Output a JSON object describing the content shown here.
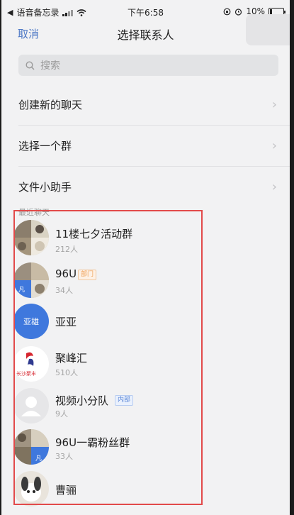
{
  "status_bar": {
    "back_app": "语音备忘录",
    "time": "下午6:58",
    "battery": "10%"
  },
  "nav": {
    "cancel": "取消",
    "title": "选择联系人"
  },
  "search": {
    "placeholder": "搜索"
  },
  "menu": [
    {
      "label": "创建新的聊天"
    },
    {
      "label": "选择一个群"
    },
    {
      "label": "文件小助手"
    }
  ],
  "section_label": "最近聊天",
  "contacts": [
    {
      "name": "11楼七夕活动群",
      "count": "212人"
    },
    {
      "name": "96U",
      "tag": "部门",
      "count": "34人",
      "avatar_badge": "凡"
    },
    {
      "name": "亚亚",
      "avatar_text": "亚雄"
    },
    {
      "name": "聚峰汇",
      "count": "510人",
      "avatar_text": "长沙聚丰"
    },
    {
      "name": "视频小分队",
      "tag": "内部",
      "count": "9人"
    },
    {
      "name": "96U一霸粉丝群",
      "count": "33人",
      "avatar_badge": "凡"
    },
    {
      "name": "曹骊"
    }
  ],
  "colors": {
    "accent_blue": "#4e79c6",
    "highlight_red": "#e24a4a",
    "avatar_blue": "#3f78dd"
  }
}
